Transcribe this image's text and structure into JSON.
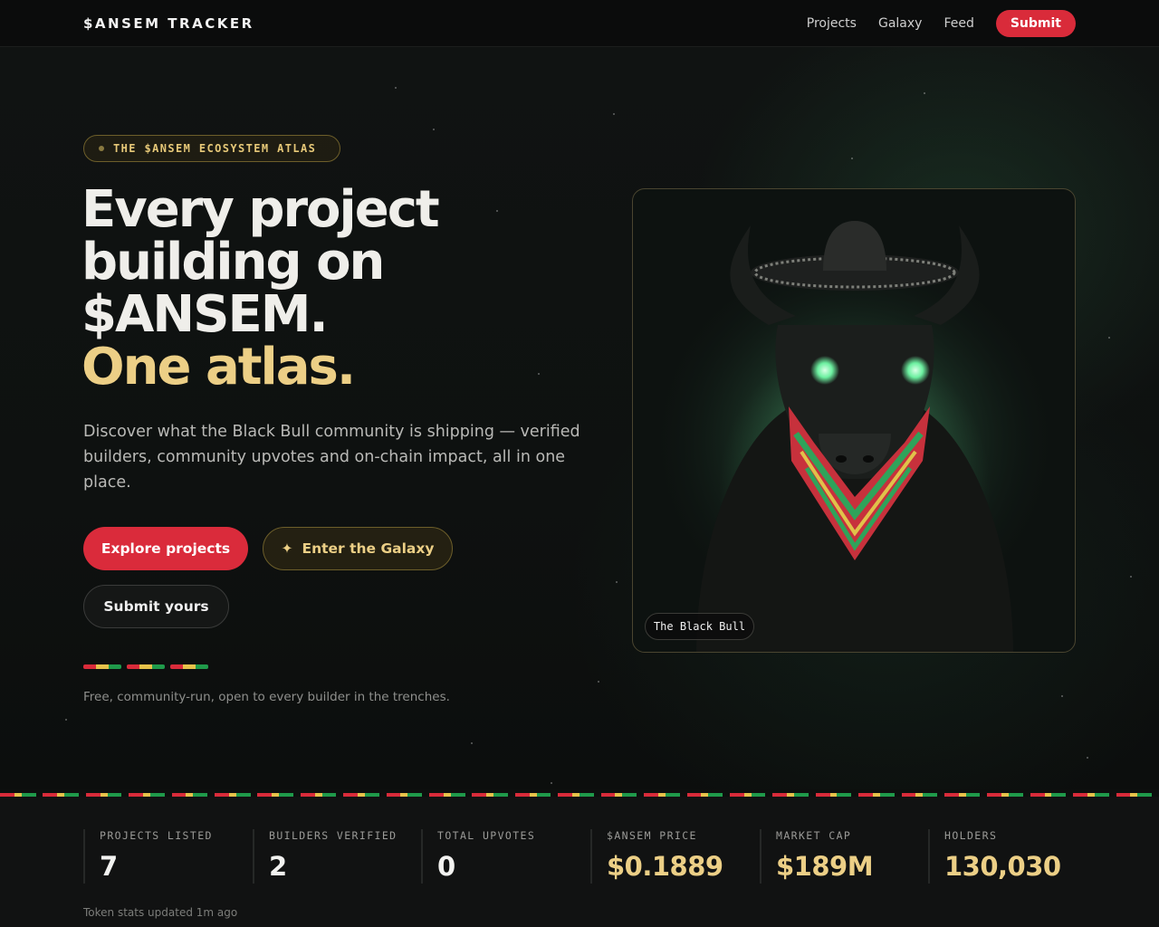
{
  "nav": {
    "brand": "$ANSEM TRACKER",
    "links": [
      "Projects",
      "Galaxy",
      "Feed"
    ],
    "submit": "Submit"
  },
  "hero": {
    "eyebrow": "THE $ANSEM ECOSYSTEM ATLAS",
    "headline_lines": [
      "Every project",
      "building on",
      "$ANSEM."
    ],
    "headline_accent": "One atlas.",
    "lede": "Discover what the Black Bull community is shipping — verified builders, community upvotes and on-chain impact, all in one place.",
    "buttons": {
      "explore": "Explore projects",
      "galaxy": "Enter the Galaxy",
      "galaxy_icon": "✦",
      "submit": "Submit yours"
    },
    "tagline": "Free, community-run, open to every builder in the trenches.",
    "image_label": "The Black Bull"
  },
  "stats": [
    {
      "label": "PROJECTS LISTED",
      "value": "7"
    },
    {
      "label": "BUILDERS VERIFIED",
      "value": "2"
    },
    {
      "label": "TOTAL UPVOTES",
      "value": "0"
    },
    {
      "label": "$ANSEM PRICE",
      "value": "$0.1889"
    },
    {
      "label": "MARKET CAP",
      "value": "$189M"
    },
    {
      "label": "HOLDERS",
      "value": "130,030"
    }
  ],
  "stats_updated": "Token stats updated 1m ago",
  "colors": {
    "accent_red": "#da2b3b",
    "accent_gold": "#eccf86",
    "flag_green": "#1f9a4a",
    "flag_yellow": "#e7c24a",
    "flag_red": "#d92b3a",
    "background": "#0d0f0e"
  }
}
